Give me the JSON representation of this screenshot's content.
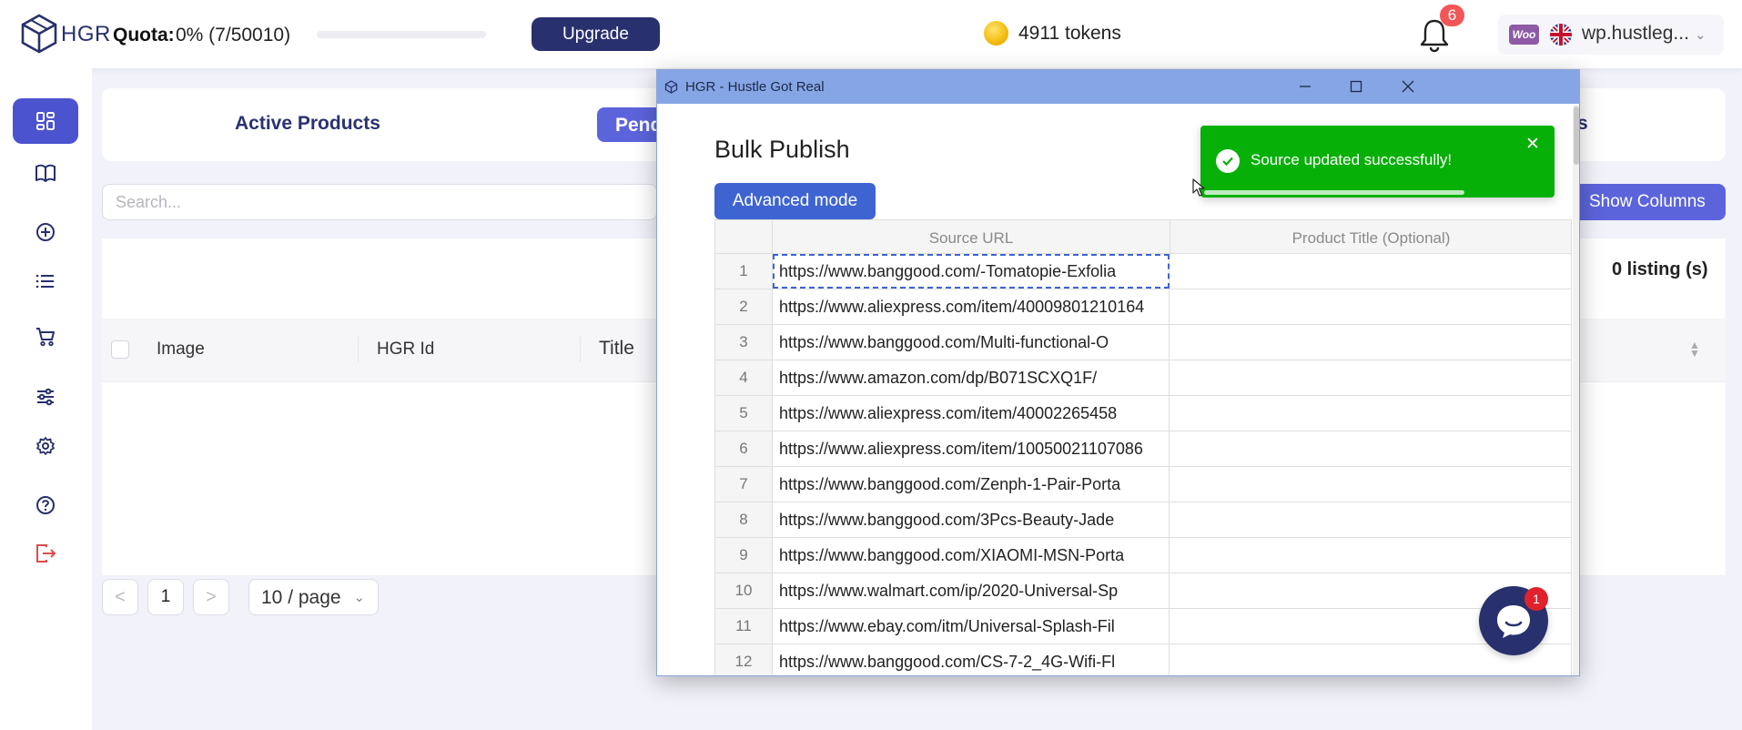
{
  "topbar": {
    "brand": "HGR",
    "quota_label": "Quota:",
    "quota_value": "0% (7/50010)",
    "quota_progress": 0,
    "upgrade_label": "Upgrade",
    "tokens": "4911 tokens",
    "notification_count": "6",
    "woo_label": "Woo",
    "store_name": "wp.hustleg..."
  },
  "sidebar": {
    "items": [
      {
        "icon": "dashboard-icon",
        "active": true
      },
      {
        "icon": "book-icon",
        "active": false
      },
      {
        "icon": "add-circle-icon",
        "active": false
      },
      {
        "icon": "list-icon",
        "active": false
      },
      {
        "icon": "cart-icon",
        "active": false
      },
      {
        "icon": "sliders-icon",
        "active": false
      },
      {
        "icon": "gear-icon",
        "active": false
      },
      {
        "icon": "help-icon",
        "active": false
      },
      {
        "icon": "logout-icon",
        "active": false
      }
    ]
  },
  "main": {
    "tabs": [
      {
        "label": "Active Products"
      },
      {
        "label": "Pend"
      },
      {
        "label": "s"
      }
    ],
    "search_placeholder": "Search...",
    "show_columns_label": "Show Columns",
    "listing_count": "0 listing (s)",
    "columns": [
      "Image",
      "HGR Id",
      "Title"
    ],
    "pagination": {
      "prev": "<",
      "current": "1",
      "next": ">",
      "page_size": "10 / page"
    }
  },
  "modal": {
    "window_title": "HGR - Hustle Got Real",
    "heading": "Bulk Publish",
    "advanced_mode_label": "Advanced mode",
    "columns": [
      "Source URL",
      "Product Title (Optional)"
    ],
    "rows": [
      {
        "num": "1",
        "url": "https://www.banggood.com/-Tomatopie-Exfolia",
        "title": ""
      },
      {
        "num": "2",
        "url": "https://www.aliexpress.com/item/40009801210164",
        "title": ""
      },
      {
        "num": "3",
        "url": "https://www.banggood.com/Multi-functional-O",
        "title": ""
      },
      {
        "num": "4",
        "url": "https://www.amazon.com/dp/B071SCXQ1F/",
        "title": ""
      },
      {
        "num": "5",
        "url": "https://www.aliexpress.com/item/40002265458",
        "title": ""
      },
      {
        "num": "6",
        "url": "https://www.aliexpress.com/item/10050021107086",
        "title": ""
      },
      {
        "num": "7",
        "url": "https://www.banggood.com/Zenph-1-Pair-Porta",
        "title": ""
      },
      {
        "num": "8",
        "url": "https://www.banggood.com/3Pcs-Beauty-Jade",
        "title": ""
      },
      {
        "num": "9",
        "url": "https://www.banggood.com/XIAOMI-MSN-Porta",
        "title": ""
      },
      {
        "num": "10",
        "url": "https://www.walmart.com/ip/2020-Universal-Sp",
        "title": ""
      },
      {
        "num": "11",
        "url": "https://www.ebay.com/itm/Universal-Splash-Fil",
        "title": ""
      },
      {
        "num": "12",
        "url": "https://www.banggood.com/CS-7-2_4G-Wifi-Fl",
        "title": ""
      }
    ]
  },
  "toast": {
    "message": "Source updated successfully!",
    "progress": 0.75
  },
  "chat": {
    "badge": "1"
  },
  "colors": {
    "brand_dark": "#28306e",
    "accent": "#5c64dc",
    "success": "#07b007",
    "titlebar": "#86a5e4",
    "advanced_button": "#3e64d2"
  }
}
